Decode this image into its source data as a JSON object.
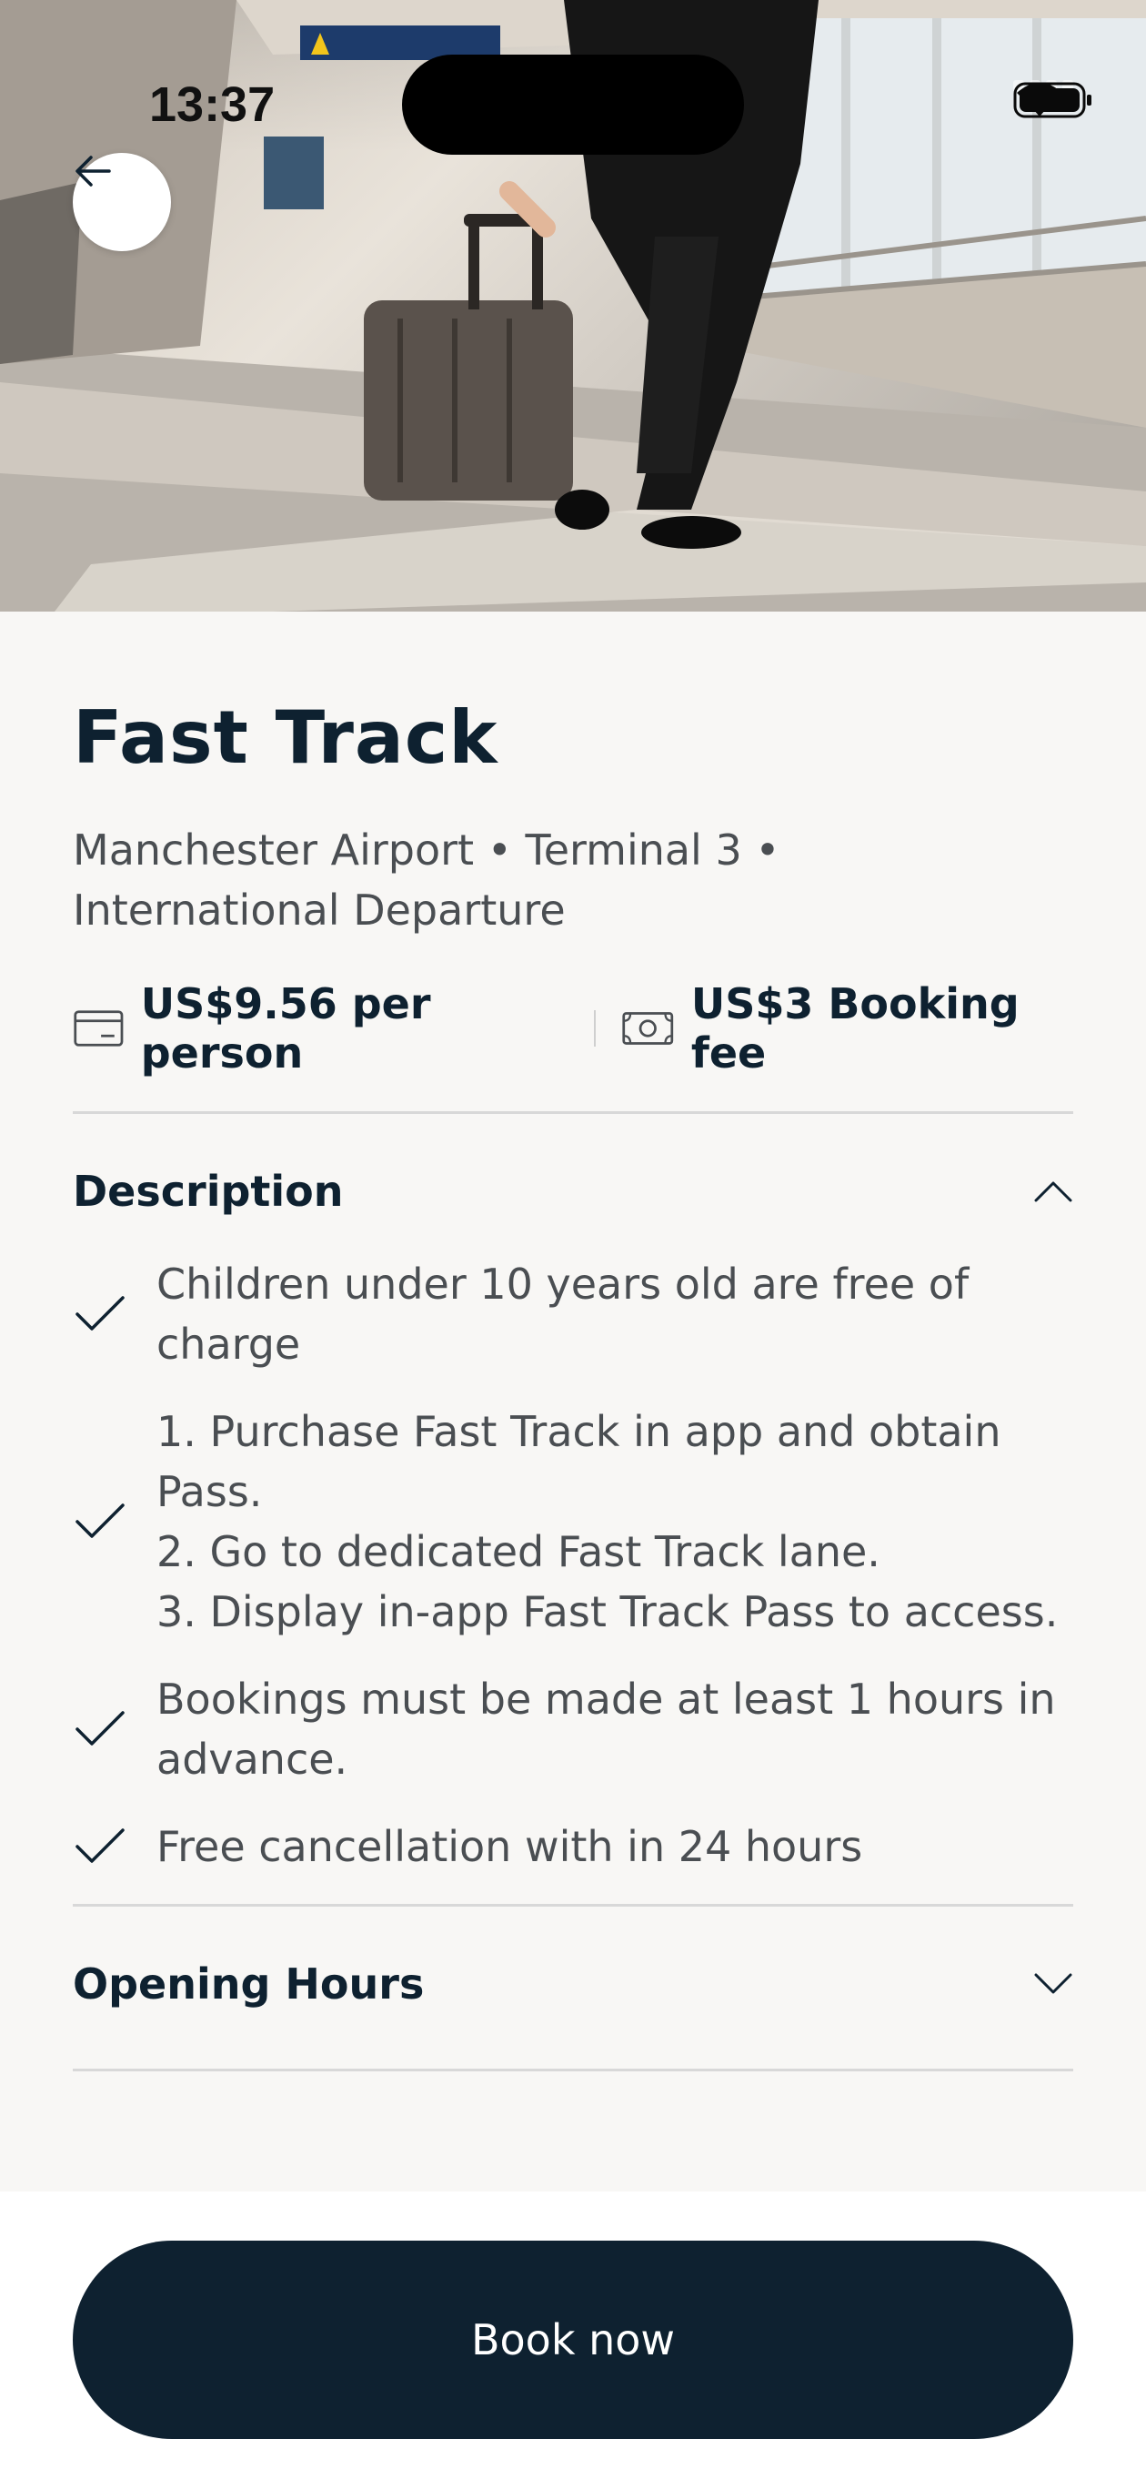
{
  "status_bar": {
    "time": "13:37"
  },
  "header": {
    "back_icon": "arrow-left-icon"
  },
  "product": {
    "title": "Fast Track",
    "location": "Manchester Airport • Terminal 3 • International Departure",
    "price": "US$9.56 per person",
    "price_icon": "card-icon",
    "booking_fee": "US$3 Booking fee",
    "booking_fee_icon": "cash-icon"
  },
  "description": {
    "title": "Description",
    "expanded": true,
    "items": [
      "Children under 10 years old are free of charge",
      "1. Purchase Fast Track in app and obtain Pass.\n2. Go to dedicated Fast Track lane.\n3. Display in-app Fast Track Pass to access.",
      "Bookings must be made at least 1 hours in advance.",
      "Free cancellation with in 24 hours"
    ]
  },
  "opening_hours": {
    "title": "Opening Hours",
    "expanded": false
  },
  "cta": {
    "label": "Book now"
  },
  "colors": {
    "primary": "#0e2130",
    "background": "#f8f7f5",
    "muted_text": "#4a4e52"
  }
}
